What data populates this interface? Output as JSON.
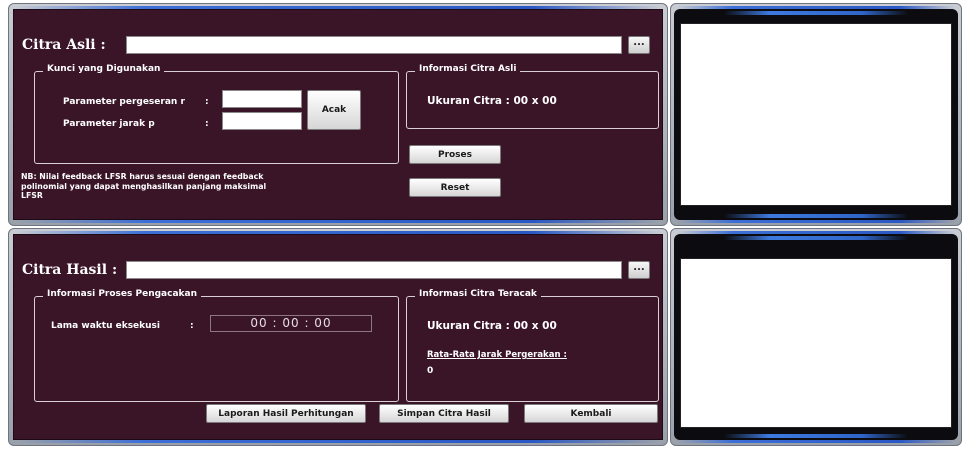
{
  "top": {
    "title": "Citra Asli  :",
    "path_value": "",
    "browse_label": "...",
    "key_group": {
      "title": "Kunci yang Digunakan",
      "shift_label": "Parameter pergeseran r",
      "shift_colon": ":",
      "shift_value": "",
      "distance_label": "Parameter jarak p",
      "distance_colon": ":",
      "distance_value": "",
      "random_button": "Acak"
    },
    "info_group": {
      "title": "Informasi Citra Asli",
      "size_text": "Ukuran Citra : 00 x 00"
    },
    "note": "NB: Nilai feedback LFSR harus sesuai dengan feedback polinomial yang dapat menghasilkan panjang maksimal LFSR",
    "process_button": "Proses",
    "reset_button": "Reset"
  },
  "bottom": {
    "title": "Citra Hasil  :",
    "path_value": "",
    "browse_label": "...",
    "process_group": {
      "title": "Informasi Proses Pengacakan",
      "exec_label": "Lama waktu eksekusi",
      "exec_colon": ":",
      "exec_time": "00 : 00 : 00"
    },
    "info_group": {
      "title": "Informasi Citra Teracak",
      "size_text": "Ukuran Citra : 00 x 00",
      "avg_label": "Rata-Rata Jarak Pergerakan :",
      "avg_value": "0"
    },
    "report_button": "Laporan Hasil Perhitungan",
    "save_button": "Simpan Citra Hasil",
    "back_button": "Kembali"
  },
  "colors": {
    "panel": "#3a1528",
    "frame": "#a7abb4",
    "accent": "#2f65c9"
  }
}
